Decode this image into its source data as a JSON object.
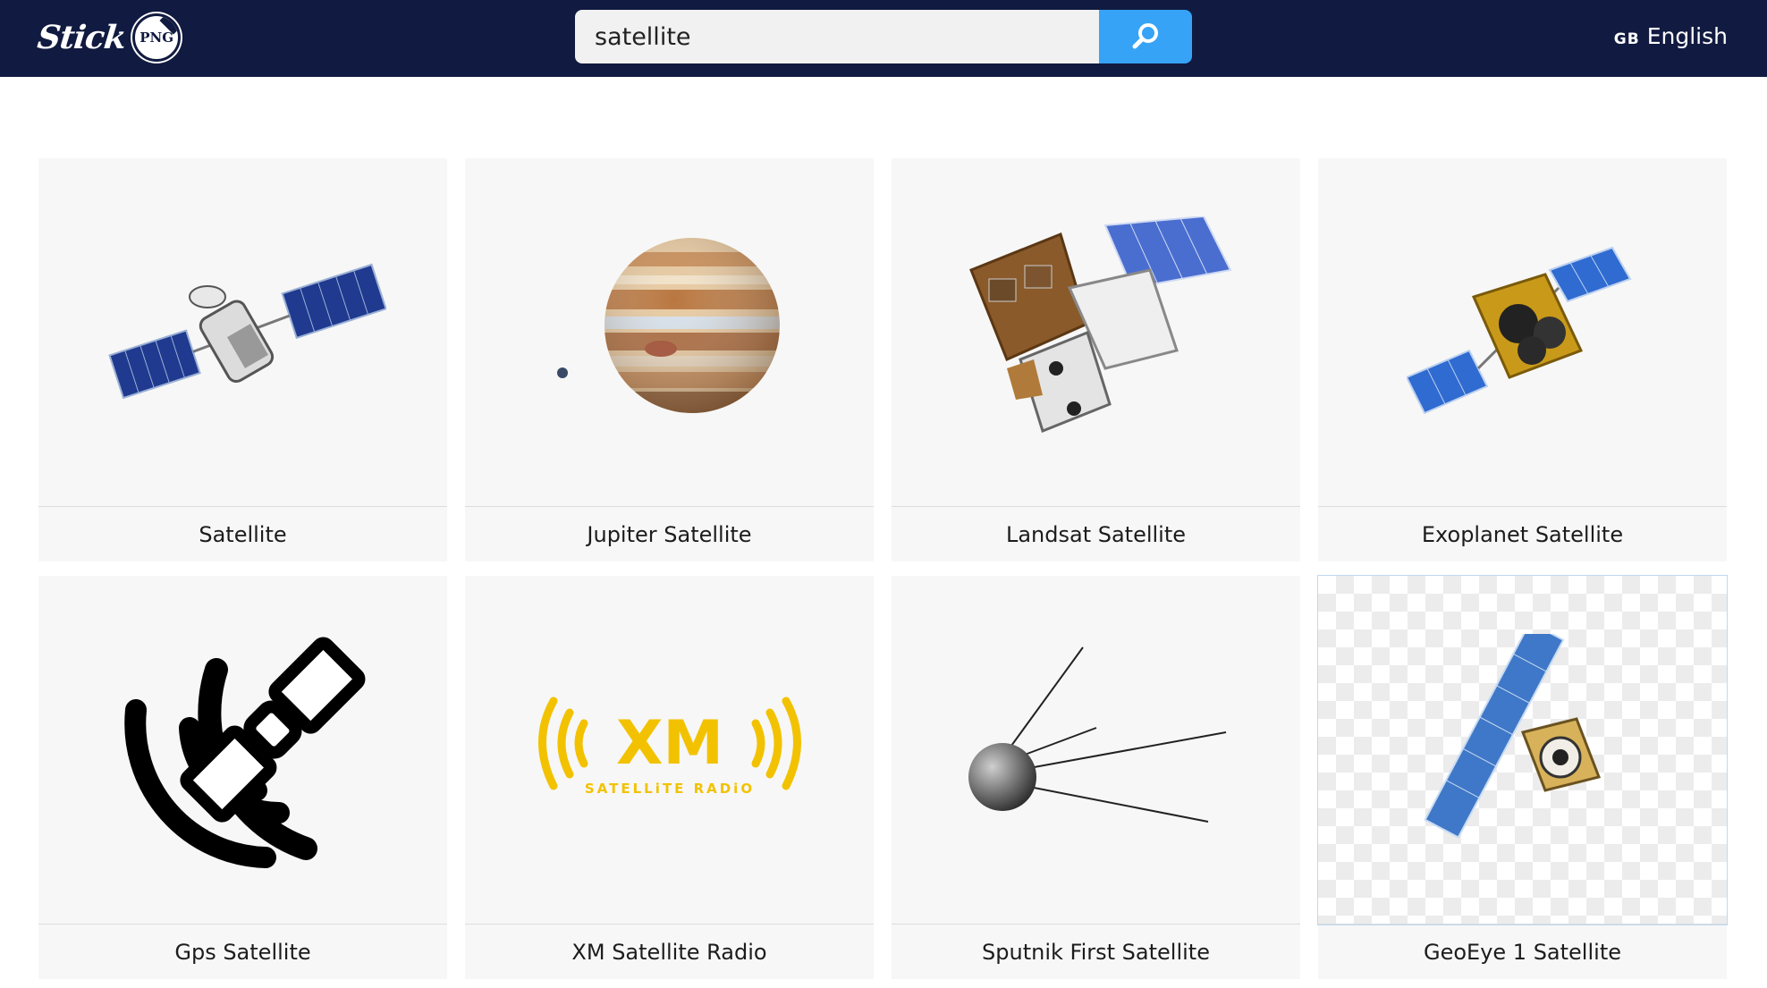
{
  "header": {
    "logo_text": "Stick",
    "logo_badge": "PNG",
    "search_value": "satellite",
    "language_flag": "GB",
    "language_label": "English"
  },
  "results": [
    {
      "title": "Satellite",
      "image": "satellite-icon"
    },
    {
      "title": "Jupiter Satellite",
      "image": "jupiter-icon"
    },
    {
      "title": "Landsat Satellite",
      "image": "landsat-satellite-icon"
    },
    {
      "title": "Exoplanet Satellite",
      "image": "exoplanet-satellite-icon"
    },
    {
      "title": "Gps Satellite",
      "image": "gps-satellite-icon"
    },
    {
      "title": "XM Satellite Radio",
      "image": "xm-satellite-radio-logo",
      "logo_text": "XM",
      "logo_subtext": "SATELLiTE RADiO"
    },
    {
      "title": "Sputnik First Satellite",
      "image": "sputnik-icon"
    },
    {
      "title": "GeoEye 1 Satellite",
      "image": "geoeye-satellite-icon"
    }
  ],
  "colors": {
    "header_bg": "#111a40",
    "search_button": "#36a3f7",
    "card_bg": "#f7f7f7",
    "panel_blue": "#1f3a8f",
    "xm_yellow": "#f2c200"
  }
}
